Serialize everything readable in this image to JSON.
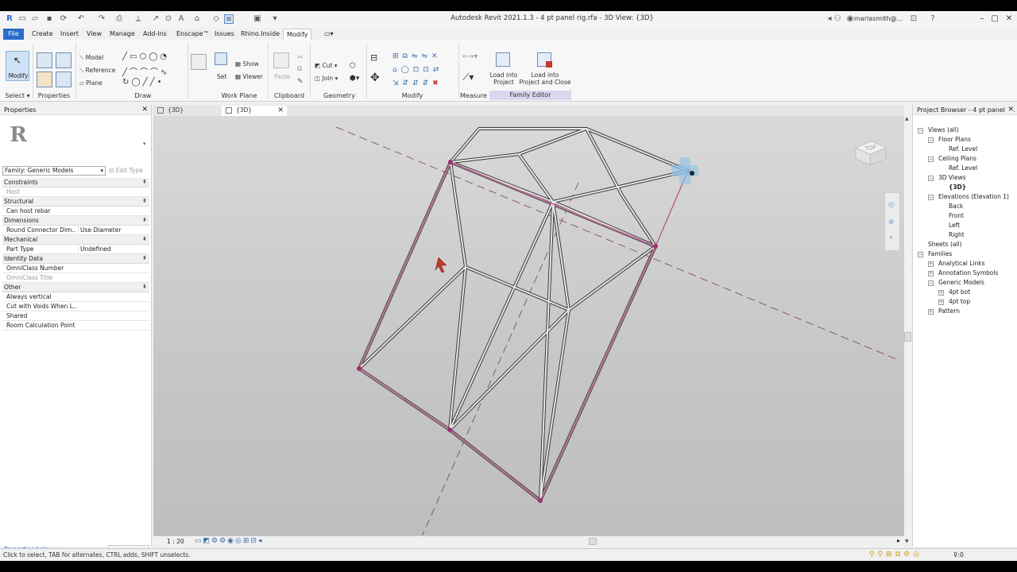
{
  "title_bar": {
    "title": "Autodesk Revit 2021.1.3 - 4 pt panel rig.rfa - 3D View: {3D}",
    "user": "marlasmith@...",
    "help": "?"
  },
  "ribbon_tabs": [
    {
      "label": "File"
    },
    {
      "label": "Create"
    },
    {
      "label": "Insert"
    },
    {
      "label": "View"
    },
    {
      "label": "Manage"
    },
    {
      "label": "Add-Ins"
    },
    {
      "label": "Enscape™"
    },
    {
      "label": "Issues"
    },
    {
      "label": "Rhino.Inside"
    },
    {
      "label": "Modify"
    }
  ],
  "ribbon": {
    "select": {
      "modify": "Modify",
      "select_label": "Select ▾"
    },
    "properties_label": "Properties",
    "draw": {
      "model": "Model",
      "reference": "Reference",
      "plane": "Plane",
      "label": "Draw"
    },
    "work_plane": {
      "set": "Set",
      "show": "Show",
      "viewer": "Viewer",
      "label": "Work Plane"
    },
    "clipboard": {
      "paste": "Paste",
      "label": "Clipboard"
    },
    "geometry": {
      "cut": "Cut",
      "join": "Join",
      "label": "Geometry"
    },
    "modify_label": "Modify",
    "measure_label": "Measure",
    "family_editor": {
      "load_project_1": "Load into",
      "load_project_2": "Project",
      "load_close_1": "Load into",
      "load_close_2": "Project and Close",
      "label": "Family Editor"
    }
  },
  "properties": {
    "header": "Properties",
    "family_select": "Family: Generic Models",
    "edit_type": "Edit Type",
    "help": "Properties help",
    "apply": "Apply",
    "rows": [
      {
        "kind": "section",
        "name": "Constraints"
      },
      {
        "kind": "param",
        "name": "Host",
        "value": "",
        "dim": true
      },
      {
        "kind": "section",
        "name": "Structural"
      },
      {
        "kind": "check",
        "name": "Can host rebar",
        "checked": false
      },
      {
        "kind": "section",
        "name": "Dimensions"
      },
      {
        "kind": "param",
        "name": "Round Connector Dim...",
        "value": "Use Diameter"
      },
      {
        "kind": "section",
        "name": "Mechanical"
      },
      {
        "kind": "param",
        "name": "Part Type",
        "value": "Undefined"
      },
      {
        "kind": "section",
        "name": "Identity Data"
      },
      {
        "kind": "param",
        "name": "OmniClass Number",
        "value": ""
      },
      {
        "kind": "param",
        "name": "OmniClass Title",
        "value": "",
        "dim": true
      },
      {
        "kind": "section",
        "name": "Other"
      },
      {
        "kind": "check",
        "name": "Always vertical",
        "checked": false
      },
      {
        "kind": "check",
        "name": "Cut with Voids When L...",
        "checked": false
      },
      {
        "kind": "check",
        "name": "Shared",
        "checked": true
      },
      {
        "kind": "check",
        "name": "Room Calculation Point",
        "checked": false
      }
    ]
  },
  "view_tabs": [
    {
      "label": "{3D}",
      "active": false
    },
    {
      "label": "{3D}",
      "active": true
    }
  ],
  "viewcube_label": "TOP",
  "view_scale": "1 : 20",
  "project_browser": {
    "header": "Project Browser - 4 pt panel r...",
    "items": [
      {
        "label": "Views (all)",
        "depth": 0,
        "toggle": "−"
      },
      {
        "label": "Floor Plans",
        "depth": 1,
        "toggle": "−"
      },
      {
        "label": "Ref. Level",
        "depth": 2
      },
      {
        "label": "Ceiling Plans",
        "depth": 1,
        "toggle": "−"
      },
      {
        "label": "Ref. Level",
        "depth": 2
      },
      {
        "label": "3D Views",
        "depth": 1,
        "toggle": "−"
      },
      {
        "label": "{3D}",
        "depth": 2,
        "selected": true
      },
      {
        "label": "Elevations (Elevation 1)",
        "depth": 1,
        "toggle": "−"
      },
      {
        "label": "Back",
        "depth": 2
      },
      {
        "label": "Front",
        "depth": 2
      },
      {
        "label": "Left",
        "depth": 2
      },
      {
        "label": "Right",
        "depth": 2
      },
      {
        "label": "Sheets (all)",
        "depth": 0
      },
      {
        "label": "Families",
        "depth": 0,
        "toggle": "−"
      },
      {
        "label": "Analytical Links",
        "depth": 1,
        "toggle": "+"
      },
      {
        "label": "Annotation Symbols",
        "depth": 1,
        "toggle": "+"
      },
      {
        "label": "Generic Models",
        "depth": 1,
        "toggle": "−"
      },
      {
        "label": "4pt bot",
        "depth": 2,
        "toggle": "+"
      },
      {
        "label": "4pt top",
        "depth": 2,
        "toggle": "+"
      },
      {
        "label": "Pattern",
        "depth": 1,
        "toggle": "+"
      }
    ]
  },
  "status_bar": {
    "message": "Click to select, TAB for alternates, CTRL adds, SHIFT unselects.",
    "filter_count": ":0"
  },
  "colors": {
    "file_tab": "#2a6cc9",
    "family_editor_band": "#dcd6ee",
    "selection": "#c0508a"
  }
}
